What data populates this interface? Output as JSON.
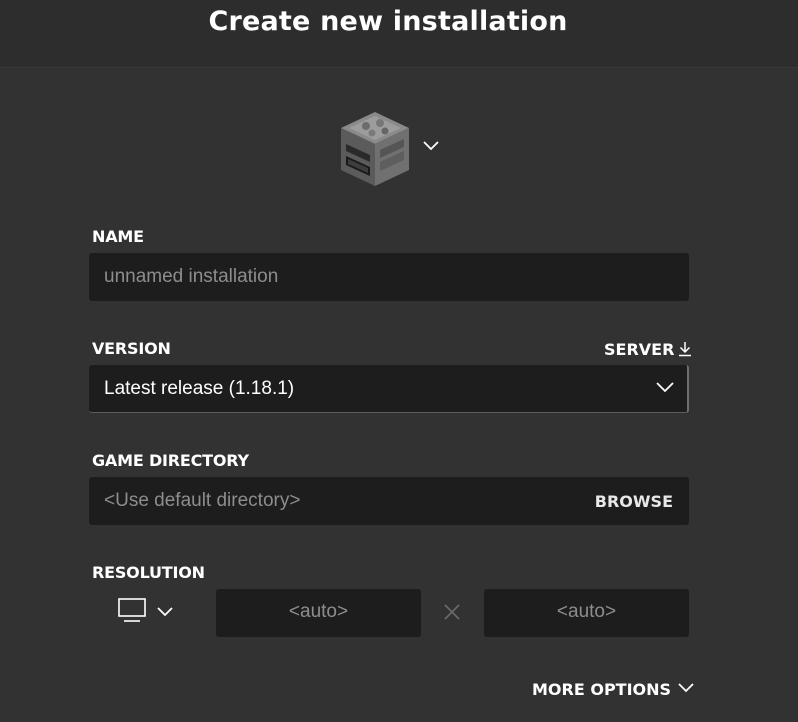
{
  "header": {
    "title": "Create new installation"
  },
  "icon_picker": {
    "icon": "furnace-block-icon"
  },
  "name": {
    "label": "NAME",
    "placeholder": "unnamed installation",
    "value": ""
  },
  "version": {
    "label": "VERSION",
    "server_label": "SERVER",
    "selected": "Latest release (1.18.1)"
  },
  "game_directory": {
    "label": "GAME DIRECTORY",
    "placeholder": "<Use default directory>",
    "browse_label": "BROWSE"
  },
  "resolution": {
    "label": "RESOLUTION",
    "width_placeholder": "<auto>",
    "height_placeholder": "<auto>",
    "separator": "×"
  },
  "more_options": {
    "label": "MORE OPTIONS"
  },
  "colors": {
    "background": "#323232",
    "header": "#2d2d2d",
    "field": "#1d1d1d",
    "placeholder": "#8d8d8d",
    "text": "#ffffff"
  }
}
